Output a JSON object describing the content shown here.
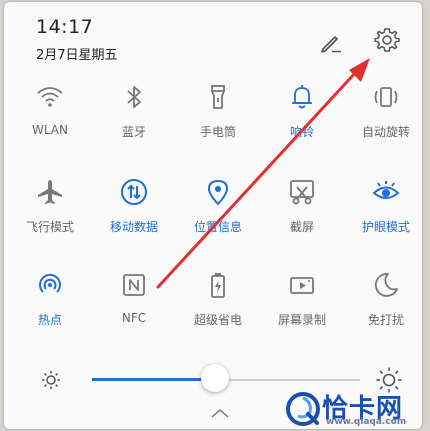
{
  "status": {
    "time": "14:17",
    "date": "2月7日星期五"
  },
  "tiles": [
    {
      "label": "WLAN",
      "active": false
    },
    {
      "label": "蓝牙",
      "active": false
    },
    {
      "label": "手电筒",
      "active": false
    },
    {
      "label": "响铃",
      "active": true
    },
    {
      "label": "自动旋转",
      "active": false
    },
    {
      "label": "飞行模式",
      "active": false
    },
    {
      "label": "移动数据",
      "active": true
    },
    {
      "label": "位置信息",
      "active": true
    },
    {
      "label": "截屏",
      "active": false
    },
    {
      "label": "护眼模式",
      "active": true
    },
    {
      "label": "热点",
      "active": true
    },
    {
      "label": "NFC",
      "active": false
    },
    {
      "label": "超级省电",
      "active": false
    },
    {
      "label": "屏幕录制",
      "active": false
    },
    {
      "label": "免打扰",
      "active": false
    }
  ],
  "brightness": {
    "level": 0.46
  },
  "colors": {
    "accent": "#1f6fd6",
    "icon": "#777777",
    "arrow": "#e0302f"
  },
  "watermark": {
    "name": "恰卡网",
    "url": "www.qiaqa.com"
  }
}
